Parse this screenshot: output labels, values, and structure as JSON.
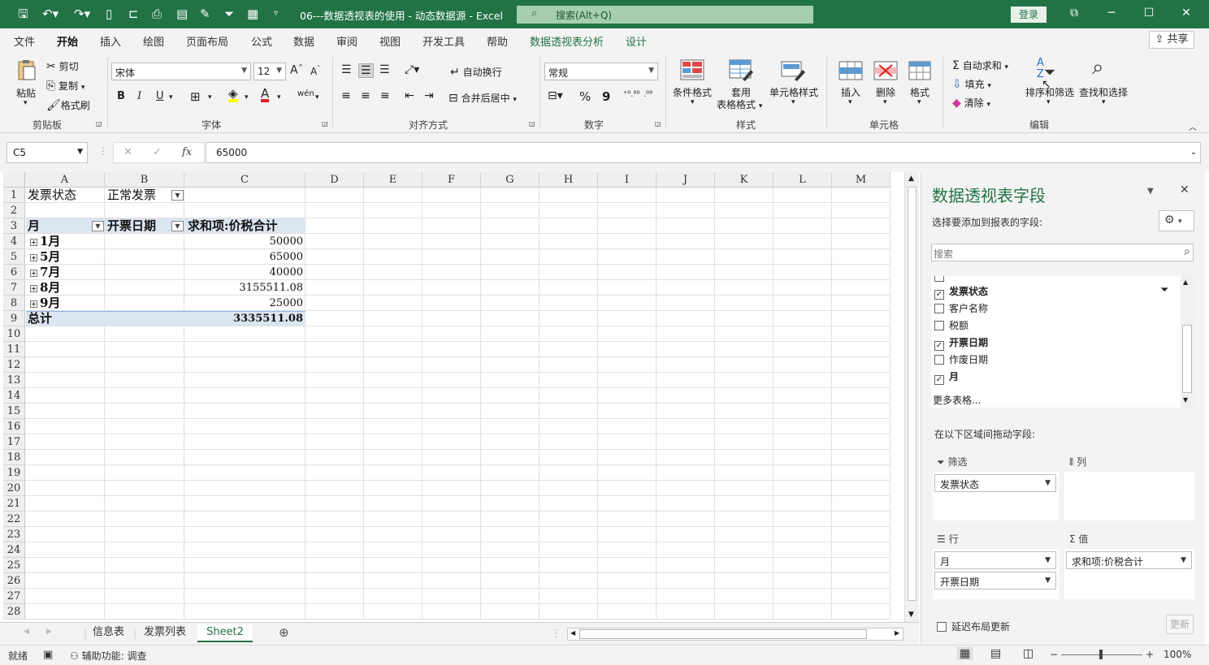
{
  "title_bar": {
    "doc_title": "06---数据透视表的使用 - 动态数据源  -  Excel",
    "search_placeholder": "搜索(Alt+Q)",
    "login_label": "登录"
  },
  "ribbon_tabs": [
    "文件",
    "开始",
    "插入",
    "绘图",
    "页面布局",
    "公式",
    "数据",
    "审阅",
    "视图",
    "开发工具",
    "帮助",
    "数据透视表分析",
    "设计"
  ],
  "share_label": "共享",
  "ribbon": {
    "clipboard": {
      "paste": "粘贴",
      "cut": "剪切",
      "copy": "复制",
      "format_painter": "格式刷",
      "label": "剪贴板"
    },
    "font": {
      "name": "宋体",
      "size": "12",
      "label": "字体",
      "bold": "B",
      "italic": "I",
      "underline": "U"
    },
    "alignment": {
      "wrap": "自动换行",
      "merge": "合并后居中",
      "label": "对齐方式"
    },
    "number": {
      "format": "常规",
      "label": "数字",
      "percent": "%",
      "comma": "9"
    },
    "styles": {
      "conditional": "条件格式",
      "table_1": "套用",
      "table_2": "表格格式",
      "cell_styles": "单元格样式",
      "label": "样式"
    },
    "cells": {
      "insert": "插入",
      "delete": "删除",
      "format": "格式",
      "label": "单元格"
    },
    "editing": {
      "autosum": "自动求和",
      "fill": "填充",
      "clear": "清除",
      "sort_filter": "排序和筛选",
      "find_select": "查找和选择",
      "label": "编辑"
    }
  },
  "formula_bar": {
    "name_box": "C5",
    "formula": "65000",
    "fx": "fx"
  },
  "columns": [
    "A",
    "B",
    "C",
    "D",
    "E",
    "F",
    "G",
    "H",
    "I",
    "J",
    "K",
    "L",
    "M"
  ],
  "rows": [
    "1",
    "2",
    "3",
    "4",
    "5",
    "6",
    "7",
    "8",
    "9",
    "10",
    "11",
    "12",
    "13",
    "14",
    "15",
    "16",
    "17",
    "18",
    "19",
    "20",
    "21",
    "22",
    "23",
    "24",
    "25",
    "26",
    "27",
    "28"
  ],
  "pivot": {
    "filter_label": "发票状态",
    "filter_value": "正常发票",
    "header_month": "月",
    "header_date": "开票日期",
    "header_sum": "求和项:价税合计",
    "rows": [
      {
        "month": "1月",
        "value": "50000"
      },
      {
        "month": "5月",
        "value": "65000"
      },
      {
        "month": "7月",
        "value": "40000"
      },
      {
        "month": "8月",
        "value": "3155511.08"
      },
      {
        "month": "9月",
        "value": "25000"
      }
    ],
    "total_label": "总计",
    "total_value": "3335511.08"
  },
  "sheet_tabs": [
    "信息表",
    "发票列表",
    "Sheet2"
  ],
  "active_sheet": "Sheet2",
  "status": {
    "ready": "就绪",
    "accessibility": "辅助功能: 调查",
    "zoom": "100%"
  },
  "pane": {
    "title": "数据透视表字段",
    "subtitle": "选择要添加到报表的字段:",
    "search_placeholder": "搜索",
    "fields": [
      {
        "name": "发票状态",
        "checked": true,
        "bold": true
      },
      {
        "name": "客户名称",
        "checked": false,
        "bold": false
      },
      {
        "name": "税额",
        "checked": false,
        "bold": false
      },
      {
        "name": "开票日期",
        "checked": true,
        "bold": true
      },
      {
        "name": "作废日期",
        "checked": false,
        "bold": false
      },
      {
        "name": "月",
        "checked": true,
        "bold": true
      }
    ],
    "more_tables": "更多表格...",
    "drag_hint": "在以下区域间拖动字段:",
    "area_filter": "筛选",
    "area_columns": "列",
    "area_rows": "行",
    "area_values": "值",
    "filter_chip": "发票状态",
    "row_chip_1": "月",
    "row_chip_2": "开票日期",
    "value_chip": "求和项:价税合计",
    "defer_label": "延迟布局更新",
    "update_label": "更新"
  },
  "colors": {
    "excel_green": "#217346",
    "pivot_header_blue": "#dce6f1"
  }
}
